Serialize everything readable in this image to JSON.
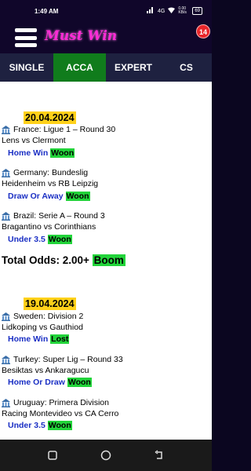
{
  "status_bar": {
    "time": "1:49 AM",
    "network": "4G",
    "speed": "0.00 KB/s",
    "battery": "69"
  },
  "header": {
    "logo_text": "Must Win",
    "notification_count": "14"
  },
  "tabs": [
    {
      "label": "SINGLE",
      "active": false
    },
    {
      "label": "ACCA",
      "active": true
    },
    {
      "label": "EXPERT",
      "active": false
    },
    {
      "label": "CS",
      "active": false
    }
  ],
  "groups": [
    {
      "date": "20.04.2024",
      "matches": [
        {
          "league": "France: Ligue 1 – Round 30",
          "teams": "Lens vs Clermont",
          "pick": "Home Win",
          "result": "Woon"
        },
        {
          "league": "Germany: Bundeslig",
          "teams": "Heidenheim vs RB Leipzig",
          "pick": "Draw Or Away",
          "result": "Woon"
        },
        {
          "league": "Brazil: Serie A – Round 3",
          "teams": "Bragantino vs Corinthians",
          "pick": "Under 3.5",
          "result": "Woon"
        }
      ],
      "total_odds_label": "Total Odds: 2.00+",
      "total_result": "Boom"
    },
    {
      "date": "19.04.2024",
      "matches": [
        {
          "league": "Sweden: Division 2",
          "teams": "Lidkoping vs Gauthiod",
          "pick": "Home Win",
          "result": "Lost"
        },
        {
          "league": "Turkey: Super Lig – Round 33",
          "teams": "Besiktas vs Ankaragucu",
          "pick": "Home Or Draw",
          "result": "Woon"
        },
        {
          "league": "Uruguay: Primera Division",
          "teams": "Racing Montevideo vs CA Cerro",
          "pick": "Under 3.5",
          "result": "Woon"
        }
      ]
    }
  ],
  "colors": {
    "accent_tab": "#107c1c",
    "date_highlight": "#ffd11a",
    "result_highlight": "#22d43a",
    "pick_text": "#1a2fc4",
    "logo": "#ff2bd6",
    "badge": "#e8262a"
  }
}
